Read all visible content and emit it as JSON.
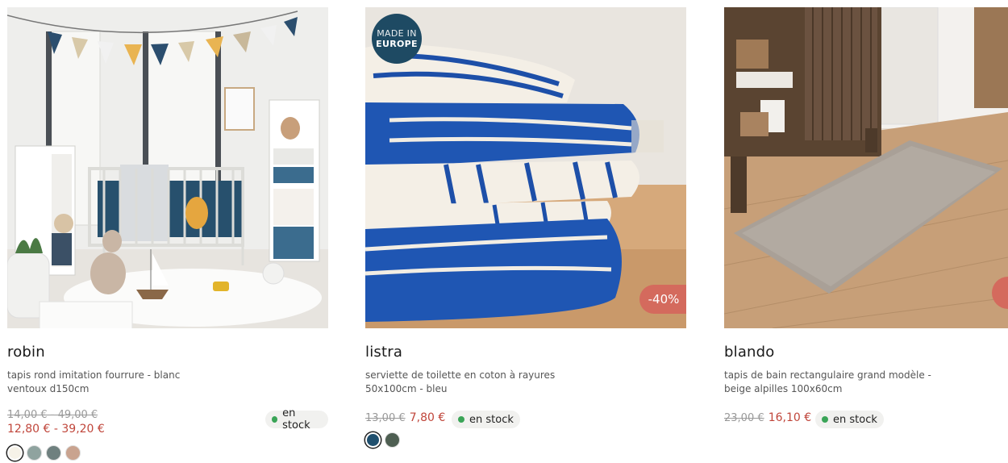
{
  "products": [
    {
      "name": "robin",
      "description": "tapis rond imitation fourrure - blanc ventoux d150cm",
      "old_price": "14,00 € - 49,00 €",
      "new_price": "12,80 € - 39,20 €",
      "stock": "en stock",
      "swatches": [
        "#f6f2e8",
        "#8fa39f",
        "#6f807f",
        "#c9a38f"
      ]
    },
    {
      "name": "listra",
      "description": "serviette de toilette en coton à rayures 50x100cm - bleu",
      "old_price": "13,00 €",
      "new_price": "7,80 €",
      "stock": "en stock",
      "badge_line1": "MADE IN",
      "badge_line2": "EUROPE",
      "discount": "-40%",
      "swatches": [
        "#1f4f6e",
        "#4e5f52"
      ]
    },
    {
      "name": "blando",
      "description": "tapis de bain rectangulaire grand modèle - beige alpilles 100x60cm",
      "old_price": "23,00 €",
      "new_price": "16,10 €",
      "stock": "en stock",
      "swatches": []
    }
  ],
  "colors": {
    "sale": "#c0463b",
    "stock_dot": "#3aa457",
    "badge": "#1e4a63",
    "discount": "#d46a5d"
  },
  "icons": {
    "stock": "green-dot-icon",
    "next": "next-arrow-icon"
  }
}
